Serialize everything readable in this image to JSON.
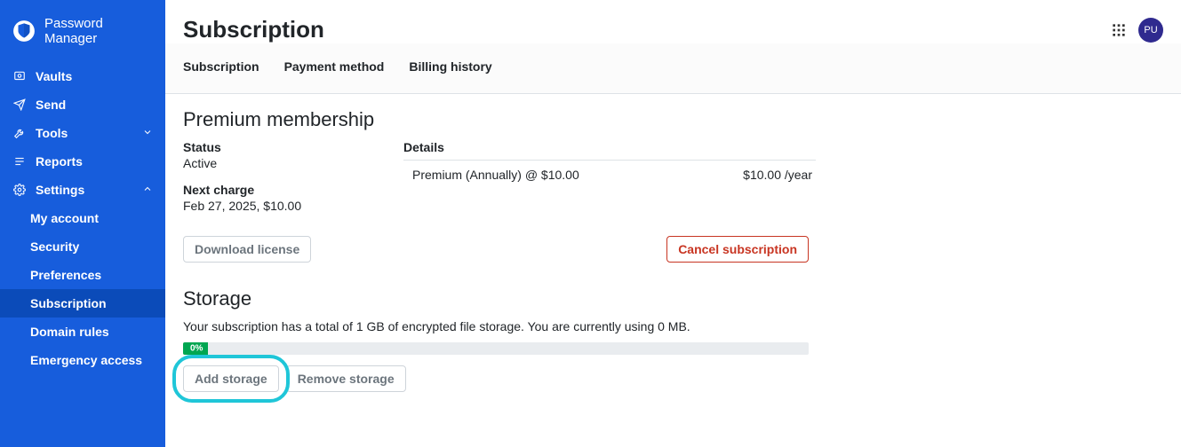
{
  "brand": {
    "name": "Password Manager"
  },
  "sidebar": {
    "items": [
      {
        "label": "Vaults"
      },
      {
        "label": "Send"
      },
      {
        "label": "Tools"
      },
      {
        "label": "Reports"
      },
      {
        "label": "Settings"
      }
    ],
    "settings_sub": [
      {
        "label": "My account"
      },
      {
        "label": "Security"
      },
      {
        "label": "Preferences"
      },
      {
        "label": "Subscription"
      },
      {
        "label": "Domain rules"
      },
      {
        "label": "Emergency access"
      }
    ]
  },
  "header": {
    "title": "Subscription",
    "avatar": "PU"
  },
  "tabs": [
    {
      "label": "Subscription"
    },
    {
      "label": "Payment method"
    },
    {
      "label": "Billing history"
    }
  ],
  "membership": {
    "title": "Premium membership",
    "status_label": "Status",
    "status_value": "Active",
    "next_charge_label": "Next charge",
    "next_charge_value": "Feb 27, 2025, $10.00",
    "details_label": "Details",
    "plan_line": "Premium (Annually) @ $10.00",
    "plan_price": "$10.00 /year",
    "download_btn": "Download license",
    "cancel_btn": "Cancel subscription"
  },
  "storage": {
    "title": "Storage",
    "desc": "Your subscription has a total of 1 GB of encrypted file storage. You are currently using 0 MB.",
    "percent": "0%",
    "add_btn": "Add storage",
    "remove_btn": "Remove storage"
  }
}
